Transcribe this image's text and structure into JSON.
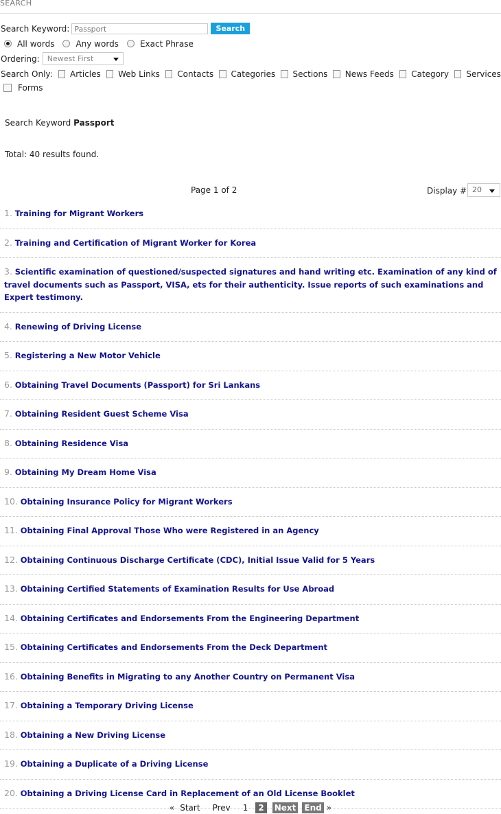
{
  "page": {
    "heading": "SEARCH"
  },
  "form": {
    "keyword_label": "Search Keyword:",
    "keyword_value": "Passport",
    "search_button": "Search",
    "radios": [
      {
        "label": "All words",
        "checked": true
      },
      {
        "label": "Any words",
        "checked": false
      },
      {
        "label": "Exact Phrase",
        "checked": false
      }
    ],
    "ordering_label": "Ordering:",
    "ordering_value": "Newest First",
    "search_only_label": "Search Only:",
    "areas": [
      "Articles",
      "Web Links",
      "Contacts",
      "Categories",
      "Sections",
      "News Feeds",
      "Category",
      "Services",
      "Forms"
    ]
  },
  "summary": {
    "keyword_prefix": "Search Keyword",
    "keyword": "Passport",
    "total": "Total: 40 results found."
  },
  "pagination": {
    "counter": "Page 1 of 2",
    "display_label": "Display #",
    "display_value": "20",
    "laquo": "«",
    "start": "Start",
    "prev": "Prev",
    "pages": [
      "1",
      "2"
    ],
    "next": "Next",
    "end": "End",
    "raquo": "»"
  },
  "results": [
    {
      "num": "1.",
      "title": "Training for Migrant Workers"
    },
    {
      "num": "2.",
      "title": "Training and Certification of Migrant Worker for Korea"
    },
    {
      "num": "3.",
      "title": "Scientific examination of questioned/suspected signatures and hand writing etc. Examination of any kind of travel documents such as Passport, VISA, ets for their authenticity. Issue reports of such examinations and Expert testimony."
    },
    {
      "num": "4.",
      "title": "Renewing of Driving License"
    },
    {
      "num": "5.",
      "title": "Registering a New Motor Vehicle"
    },
    {
      "num": "6.",
      "title": "Obtaining Travel Documents (Passport) for Sri Lankans"
    },
    {
      "num": "7.",
      "title": "Obtaining Resident Guest Scheme Visa"
    },
    {
      "num": "8.",
      "title": "Obtaining Residence Visa"
    },
    {
      "num": "9.",
      "title": "Obtaining My Dream Home Visa"
    },
    {
      "num": "10.",
      "title": "Obtaining Insurance Policy for Migrant Workers"
    },
    {
      "num": "11.",
      "title": "Obtaining Final Approval Those Who were Registered in an Agency"
    },
    {
      "num": "12.",
      "title": "Obtaining Continuous Discharge Certificate (CDC), Initial Issue Valid for 5 Years"
    },
    {
      "num": "13.",
      "title": "Obtaining Certified Statements of Examination Results for Use Abroad"
    },
    {
      "num": "14.",
      "title": "Obtaining Certificates and Endorsements From the Engineering Department"
    },
    {
      "num": "15.",
      "title": "Obtaining Certificates and Endorsements From the Deck Department"
    },
    {
      "num": "16.",
      "title": "Obtaining Benefits in Migrating to any Another Country on Permanent Visa"
    },
    {
      "num": "17.",
      "title": "Obtaining a Temporary Driving License"
    },
    {
      "num": "18.",
      "title": "Obtaining a New Driving License"
    },
    {
      "num": "19.",
      "title": "Obtaining a Duplicate of a Driving License"
    },
    {
      "num": "20.",
      "title": "Obtaining a Driving License Card in Replacement of an Old License Booklet"
    }
  ]
}
